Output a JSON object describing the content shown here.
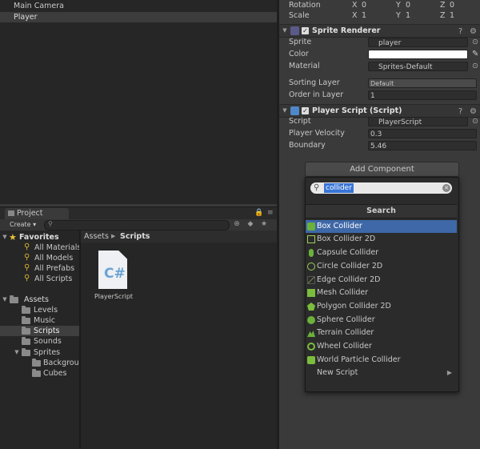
{
  "hierarchy": {
    "items": [
      {
        "label": "Main Camera",
        "selected": false
      },
      {
        "label": "Player",
        "selected": true
      }
    ]
  },
  "project": {
    "tab_label": "Project",
    "create_label": "Create ▾",
    "breadcrumb": [
      "Assets",
      "Scripts"
    ],
    "favorites_label": "Favorites",
    "favorites": [
      "All Materials",
      "All Models",
      "All Prefabs",
      "All Scripts"
    ],
    "assets_label": "Assets",
    "folders": [
      {
        "label": "Levels"
      },
      {
        "label": "Music"
      },
      {
        "label": "Scripts",
        "selected": true
      },
      {
        "label": "Sounds"
      },
      {
        "label": "Sprites"
      },
      {
        "label": "Backgrour"
      },
      {
        "label": "Cubes"
      }
    ],
    "file": {
      "glyph": "C#",
      "label": "PlayerScript"
    }
  },
  "inspector": {
    "transform": {
      "rotation_label": "Rotation",
      "scale_label": "Scale",
      "rotation": {
        "x": "0",
        "y": "0",
        "z": "0"
      },
      "scale": {
        "x": "1",
        "y": "1",
        "z": "1"
      },
      "axis_x": "X",
      "axis_y": "Y",
      "axis_z": "Z"
    },
    "sprite_renderer": {
      "title": "Sprite Renderer",
      "sprite_label": "Sprite",
      "sprite_value": "player",
      "color_label": "Color",
      "color_value": "#ffffff",
      "material_label": "Material",
      "material_value": "Sprites-Default",
      "sorting_layer_label": "Sorting Layer",
      "sorting_layer_value": "Default",
      "order_label": "Order in Layer",
      "order_value": "1"
    },
    "player_script": {
      "title": "Player Script (Script)",
      "script_label": "Script",
      "script_value": "PlayerScript",
      "velocity_label": "Player Velocity",
      "velocity_value": "0.3",
      "boundary_label": "Boundary",
      "boundary_value": "5.46"
    },
    "add_component_label": "Add Component"
  },
  "add_component_popup": {
    "search_value": "collider",
    "section_title": "Search",
    "items": [
      {
        "label": "Box Collider",
        "icon": "box-collider-icon",
        "selected": true
      },
      {
        "label": "Box Collider 2D",
        "icon": "box-collider-2d-icon"
      },
      {
        "label": "Capsule Collider",
        "icon": "capsule-collider-icon"
      },
      {
        "label": "Circle Collider 2D",
        "icon": "circle-collider-2d-icon"
      },
      {
        "label": "Edge Collider 2D",
        "icon": "edge-collider-2d-icon"
      },
      {
        "label": "Mesh Collider",
        "icon": "mesh-collider-icon"
      },
      {
        "label": "Polygon Collider 2D",
        "icon": "polygon-collider-2d-icon"
      },
      {
        "label": "Sphere Collider",
        "icon": "sphere-collider-icon"
      },
      {
        "label": "Terrain Collider",
        "icon": "terrain-collider-icon"
      },
      {
        "label": "Wheel Collider",
        "icon": "wheel-collider-icon"
      },
      {
        "label": "World Particle Collider",
        "icon": "world-particle-collider-icon"
      },
      {
        "label": "New Script",
        "icon": "",
        "submenu": true
      }
    ]
  },
  "colors": {
    "panel": "#3a3a3a",
    "dark_panel": "#262626",
    "selection": "#3e68a7",
    "highlight_text_bg": "#3875d7"
  }
}
